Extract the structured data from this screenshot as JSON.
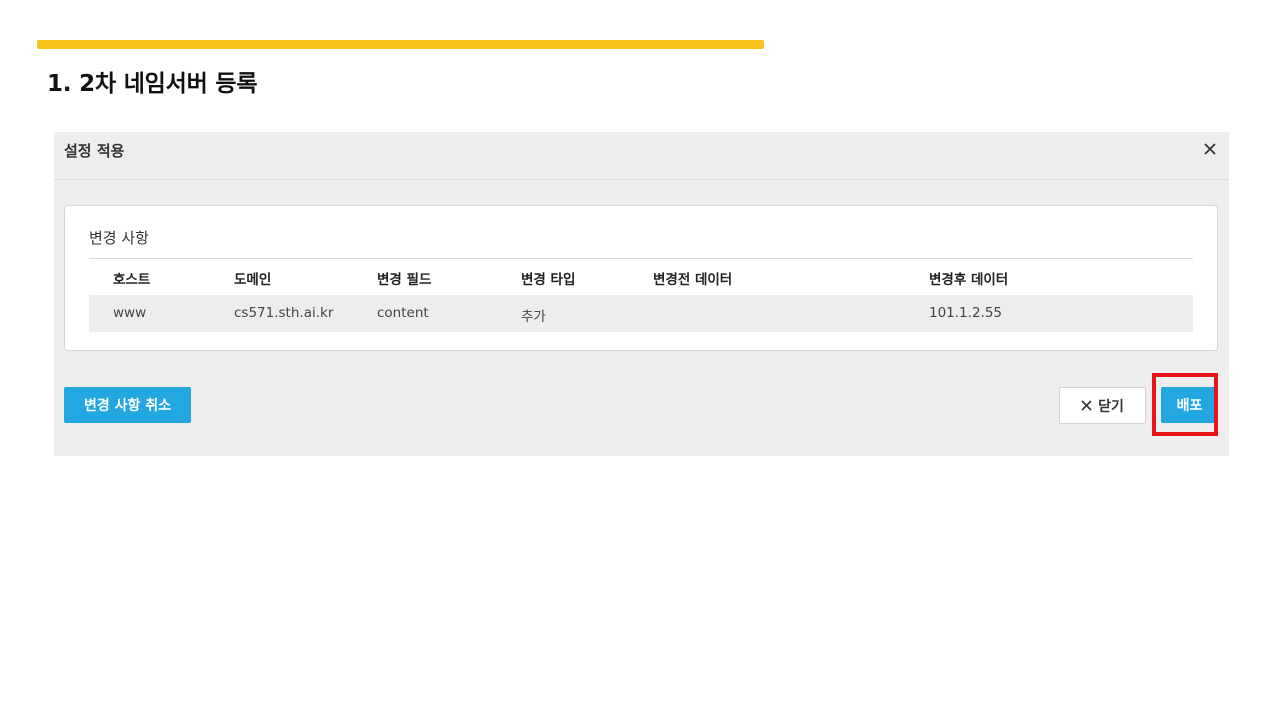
{
  "slide": {
    "title": "1. 2차 네임서버 등록",
    "accent_color": "#F7C21A",
    "highlight_color": "#E8141C"
  },
  "dialog": {
    "title": "설정 적용",
    "close_icon": "close-icon",
    "changes": {
      "title": "변경 사항",
      "columns": [
        "호스트",
        "도메인",
        "변경 필드",
        "변경 타입",
        "변경전 데이터",
        "변경후 데이터"
      ],
      "rows": [
        [
          "www",
          "cs571.sth.ai.kr",
          "content",
          "추가",
          "",
          "101.1.2.55"
        ]
      ]
    },
    "buttons": {
      "revert_label": "변경 사항 취소",
      "close_label": "닫기",
      "deploy_label": "배포"
    },
    "button_color": "#22A7E0"
  }
}
